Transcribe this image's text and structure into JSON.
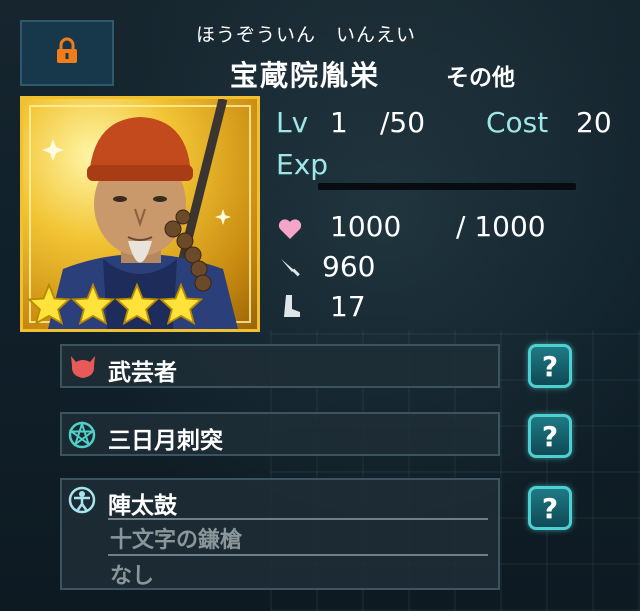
{
  "header": {
    "lock_icon": "padlock-icon",
    "furigana": "ほうぞういん　いんえい",
    "name": "宝蔵院胤栄",
    "faction": "その他"
  },
  "portrait": {
    "description_icon": "character-portrait",
    "star_count": 4
  },
  "stats": {
    "lv_label": "Lv",
    "lv_value": "1",
    "lv_max": "/50",
    "cost_label": "Cost",
    "cost_value": "20",
    "exp_label": "Exp",
    "hp_current": "1000",
    "hp_max": "/ 1000",
    "attack": "960",
    "speed": "17"
  },
  "skills": [
    {
      "icon": "demon-helmet-icon",
      "label": "武芸者"
    },
    {
      "icon": "pentagram-icon",
      "label": "三日月刺突"
    },
    {
      "icon": "person-circle-icon",
      "label": "陣太鼓",
      "sub": [
        "十文字の鎌槍",
        "なし"
      ]
    }
  ],
  "help_label": "?",
  "colors": {
    "accent_cyan": "#9fe6e6",
    "gold_frame": "#f0c030",
    "lock_orange": "#f07d1a"
  }
}
